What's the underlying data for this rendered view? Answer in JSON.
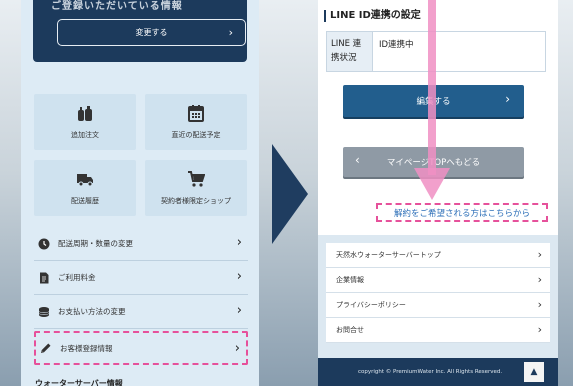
{
  "left": {
    "hero_text": "ご登録いただいている情報",
    "change_button": "変更する",
    "tiles": [
      {
        "label": "追加注文",
        "icon": "bottles-icon"
      },
      {
        "label": "直近の配送予定",
        "icon": "calendar-icon"
      },
      {
        "label": "配送履歴",
        "icon": "truck-icon"
      },
      {
        "label": "契約者様限定ショップ",
        "icon": "cart-icon"
      }
    ],
    "menu": [
      {
        "label": "配送周期・数量の変更",
        "icon": "clock-icon"
      },
      {
        "label": "ご利用料金",
        "icon": "document-icon"
      },
      {
        "label": "お支払い方法の変更",
        "icon": "coins-icon"
      },
      {
        "label": "お客様登録情報",
        "icon": "pencil-icon"
      }
    ],
    "bottom_text": "ウォーターサーバー情報"
  },
  "right": {
    "section_title": "LINE ID連携の設定",
    "table_header": "LINE 連携状況",
    "table_value": "ID連携中",
    "edit_button": "編集する",
    "mypage_button": "マイページTOPへもどる",
    "cancel_link": "解約をご希望される方はこちらから",
    "footer_links": [
      "天然水ウォーターサーバートップ",
      "企業情報",
      "プライバシーポリシー",
      "お問合せ"
    ],
    "copyright": "copyright © PremiumWater Inc. All Rights Reserved.",
    "top_button_glyph": "▲"
  },
  "colors": {
    "navy": "#1c3a5c",
    "accent_blue": "#225e8d",
    "pink_highlight": "#e6519b",
    "link_blue": "#2d6fb8"
  }
}
